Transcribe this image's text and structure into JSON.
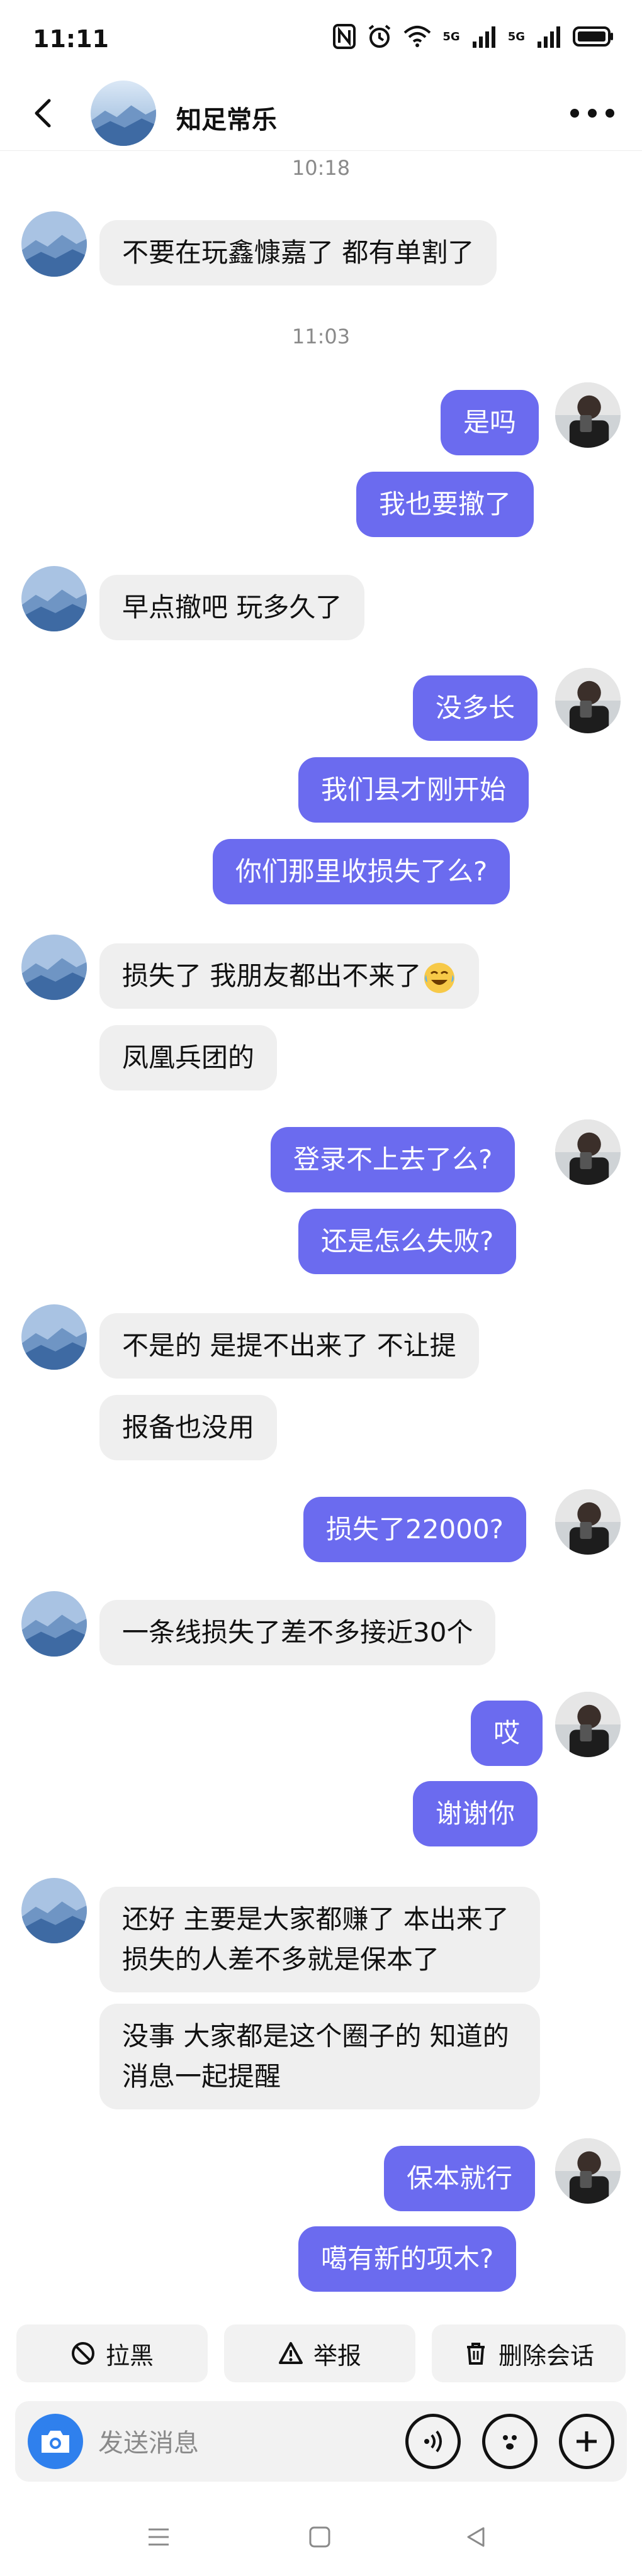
{
  "status_bar": {
    "time": "11:11",
    "net1": "5G",
    "net2": "5G"
  },
  "header": {
    "title": "知足常乐"
  },
  "messages": [
    {
      "type": "time",
      "text": "10:18"
    },
    {
      "type": "in",
      "text": "不要在玩鑫慷嘉了 都有单割了"
    },
    {
      "type": "time",
      "text": "11:03"
    },
    {
      "type": "out",
      "text": "是吗"
    },
    {
      "type": "out",
      "text": "我也要撤了"
    },
    {
      "type": "in",
      "text": "早点撤吧 玩多久了"
    },
    {
      "type": "out",
      "text": "没多长"
    },
    {
      "type": "out",
      "text": "我们县才刚开始"
    },
    {
      "type": "out",
      "text": "你们那里收损失了么?"
    },
    {
      "type": "in",
      "text": "损失了 我朋友都出不来了"
    },
    {
      "type": "in",
      "text": "凤凰兵团的"
    },
    {
      "type": "out",
      "text": "登录不上去了么?"
    },
    {
      "type": "out",
      "text": "还是怎么失败?"
    },
    {
      "type": "in",
      "text": "不是的 是提不出来了 不让提"
    },
    {
      "type": "in",
      "text": "报备也没用"
    },
    {
      "type": "out",
      "text": "损失了22000?"
    },
    {
      "type": "in",
      "text": "一条线损失了差不多接近30个"
    },
    {
      "type": "out",
      "text": "哎"
    },
    {
      "type": "out",
      "text": "谢谢你"
    },
    {
      "type": "in",
      "text": "还好 主要是大家都赚了 本出来了 损失的人差不多就是保本了"
    },
    {
      "type": "in",
      "text": "没事 大家都是这个圈子的 知道的消息一起提醒"
    },
    {
      "type": "out",
      "text": "保本就行"
    },
    {
      "type": "out",
      "text": "噶有新的项木?"
    }
  ],
  "actions": {
    "block": "拉黑",
    "report": "举报",
    "delete": "删除会话"
  },
  "composer": {
    "placeholder": "发送消息"
  }
}
